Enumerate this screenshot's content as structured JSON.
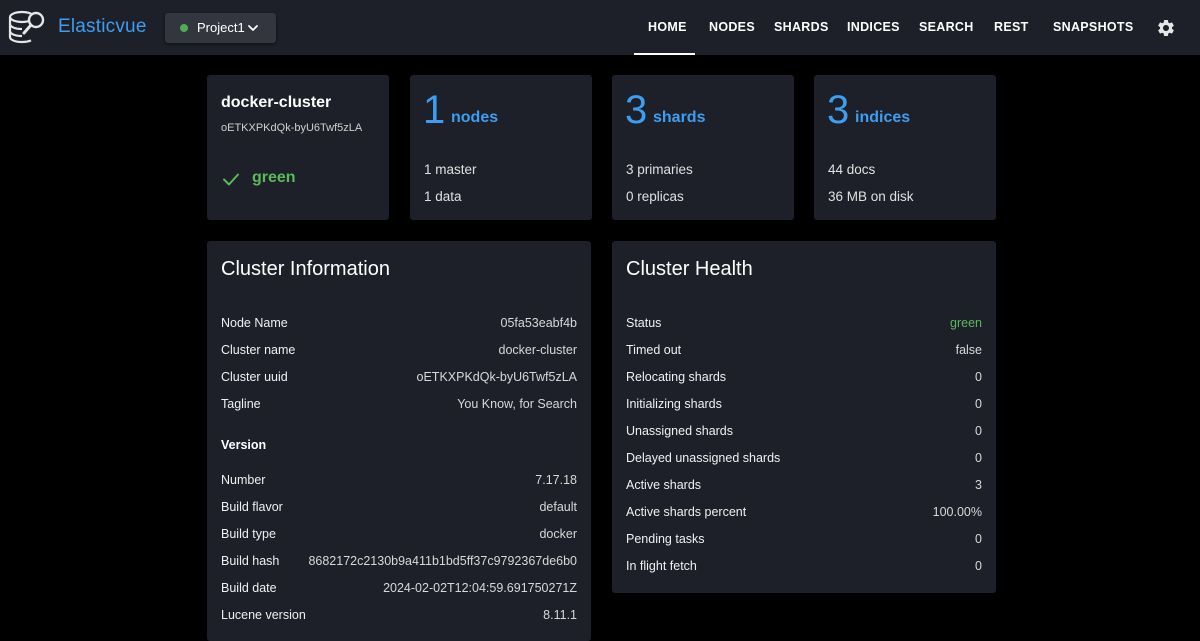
{
  "app": {
    "brand": "Elasticvue",
    "project": "Project1",
    "project_status_color": "#4caf50",
    "accent_color": "#3d9df0"
  },
  "nav": {
    "items": [
      {
        "label": "HOME",
        "active": true
      },
      {
        "label": "NODES"
      },
      {
        "label": "SHARDS"
      },
      {
        "label": "INDICES"
      },
      {
        "label": "SEARCH"
      },
      {
        "label": "REST"
      },
      {
        "label": "SNAPSHOTS"
      }
    ],
    "settings_icon": "gear-icon"
  },
  "summary": {
    "cluster": {
      "name": "docker-cluster",
      "uuid": "oETKXPKdQk-byU6Twf5zLA",
      "status": "green",
      "status_icon": "check-icon",
      "status_color": "#5cb85c"
    },
    "nodes": {
      "count": "1",
      "unit": "nodes",
      "lines": [
        "1 master",
        "1 data"
      ]
    },
    "shards": {
      "count": "3",
      "unit": "shards",
      "lines": [
        "3 primaries",
        "0 replicas"
      ]
    },
    "indices": {
      "count": "3",
      "unit": "indices",
      "lines": [
        "44 docs",
        "36 MB on disk"
      ]
    }
  },
  "cluster_info": {
    "title": "Cluster Information",
    "rows": [
      {
        "key": "Node Name",
        "value": "05fa53eabf4b"
      },
      {
        "key": "Cluster name",
        "value": "docker-cluster"
      },
      {
        "key": "Cluster uuid",
        "value": "oETKXPKdQk-byU6Twf5zLA"
      },
      {
        "key": "Tagline",
        "value": "You Know, for Search"
      }
    ],
    "version_label": "Version",
    "version_rows": [
      {
        "key": "Number",
        "value": "7.17.18"
      },
      {
        "key": "Build flavor",
        "value": "default"
      },
      {
        "key": "Build type",
        "value": "docker"
      },
      {
        "key": "Build hash",
        "value": "8682172c2130b9a411b1bd5ff37c9792367de6b0"
      },
      {
        "key": "Build date",
        "value": "2024-02-02T12:04:59.691750271Z"
      },
      {
        "key": "Lucene version",
        "value": "8.11.1"
      }
    ]
  },
  "cluster_health": {
    "title": "Cluster Health",
    "rows": [
      {
        "key": "Status",
        "value": "green"
      },
      {
        "key": "Timed out",
        "value": "false"
      },
      {
        "key": "Relocating shards",
        "value": "0"
      },
      {
        "key": "Initializing shards",
        "value": "0"
      },
      {
        "key": "Unassigned shards",
        "value": "0"
      },
      {
        "key": "Delayed unassigned shards",
        "value": "0"
      },
      {
        "key": "Active shards",
        "value": "3"
      },
      {
        "key": "Active shards percent",
        "value": "100.00%"
      },
      {
        "key": "Pending tasks",
        "value": "0"
      },
      {
        "key": "In flight fetch",
        "value": "0"
      }
    ]
  }
}
